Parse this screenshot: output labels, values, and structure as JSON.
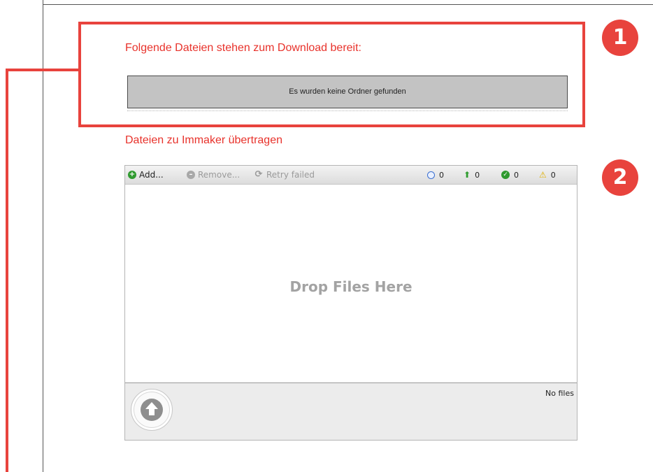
{
  "callouts": {
    "badge_1": "1",
    "badge_2": "2",
    "color": "#e8433d"
  },
  "downloads": {
    "title": "Folgende Dateien stehen zum Download bereit:",
    "empty_message": "Es wurden keine Ordner gefunden"
  },
  "upload": {
    "title": "Dateien zu Immaker übertragen",
    "toolbar": {
      "add_label": "Add...",
      "remove_label": "Remove...",
      "retry_label": "Retry failed"
    },
    "counters": {
      "queued": "0",
      "uploading": "0",
      "completed": "0",
      "failed": "0"
    },
    "drop_text": "Drop Files Here",
    "file_status": "No files"
  },
  "icons": {
    "add": "plus-circle-icon",
    "remove": "minus-circle-icon",
    "retry": "refresh-icon",
    "queued": "clock-icon",
    "uploading": "arrow-up-icon",
    "completed": "check-circle-icon",
    "failed": "warning-icon",
    "upload_button": "upload-arrow-icon"
  },
  "colors": {
    "accent_red": "#e8322b",
    "folder_box": "#c3c3c3",
    "drop_text": "#a3a3a3"
  }
}
